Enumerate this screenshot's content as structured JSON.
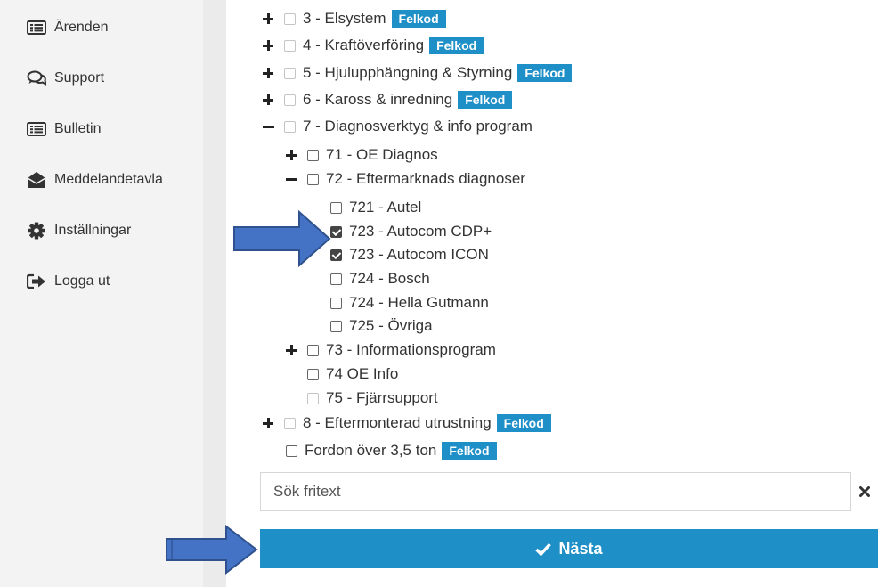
{
  "sidebar": {
    "items": [
      {
        "label": "Ärenden",
        "icon": "list-icon"
      },
      {
        "label": "Support",
        "icon": "chat-icon"
      },
      {
        "label": "Bulletin",
        "icon": "list-icon"
      },
      {
        "label": "Meddelandetavla",
        "icon": "envelope-open-icon"
      },
      {
        "label": "Inställningar",
        "icon": "gear-icon"
      },
      {
        "label": "Logga ut",
        "icon": "sign-out-icon"
      }
    ]
  },
  "tree": {
    "badge_label": "Felkod",
    "items": [
      {
        "label": "3 - Elsystem",
        "toggle": "plus",
        "checked": false,
        "badge": true
      },
      {
        "label": "4 - Kraftöverföring",
        "toggle": "plus",
        "checked": false,
        "badge": true
      },
      {
        "label": "5 - Hjulupphängning & Styrning",
        "toggle": "plus",
        "checked": false,
        "badge": true
      },
      {
        "label": "6 - Kaross & inredning",
        "toggle": "plus",
        "checked": false,
        "badge": true
      },
      {
        "label": "7 - Diagnosverktyg & info program",
        "toggle": "minus",
        "checked": false,
        "badge": false
      },
      {
        "label": "71 - OE Diagnos",
        "toggle": "plus",
        "checked": false,
        "badge": false
      },
      {
        "label": "72 - Eftermarknads diagnoser",
        "toggle": "minus",
        "checked": false,
        "badge": false
      },
      {
        "label": "721 - Autel",
        "toggle": "none",
        "checked": false,
        "badge": false
      },
      {
        "label": "723 - Autocom CDP+",
        "toggle": "none",
        "checked": true,
        "badge": false
      },
      {
        "label": "723 - Autocom ICON",
        "toggle": "none",
        "checked": true,
        "badge": false
      },
      {
        "label": "724 - Bosch",
        "toggle": "none",
        "checked": false,
        "badge": false
      },
      {
        "label": "724 - Hella Gutmann",
        "toggle": "none",
        "checked": false,
        "badge": false
      },
      {
        "label": "725 - Övriga",
        "toggle": "none",
        "checked": false,
        "badge": false
      },
      {
        "label": "73 - Informationsprogram",
        "toggle": "plus",
        "checked": false,
        "badge": false
      },
      {
        "label": "74 OE Info",
        "toggle": "none",
        "checked": false,
        "badge": false
      },
      {
        "label": "75 - Fjärrsupport",
        "toggle": "none",
        "checked": false,
        "badge": false
      },
      {
        "label": "8 - Eftermonterad utrustning",
        "toggle": "plus",
        "checked": false,
        "badge": true
      },
      {
        "label": "Fordon över 3,5 ton",
        "toggle": "none",
        "checked": false,
        "badge": true
      }
    ]
  },
  "search": {
    "placeholder": "Sök fritext",
    "value": ""
  },
  "next_button": {
    "label": "Nästa"
  },
  "colors": {
    "accent": "#1f8fc8",
    "arrow": "#3f6fc7",
    "sidebar_bg": "#f3f3f3"
  }
}
